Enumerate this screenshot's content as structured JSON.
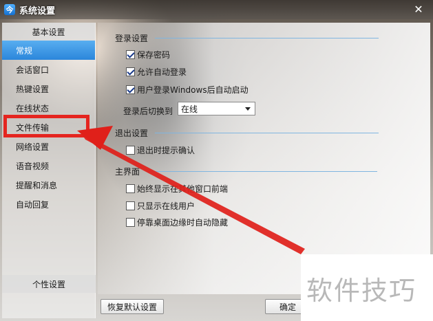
{
  "window": {
    "app_icon_glyph": "今",
    "title": "系统设置",
    "close_glyph": "✕"
  },
  "sidebar": {
    "header": "基本设置",
    "items": [
      {
        "label": "常规",
        "active": true
      },
      {
        "label": "会话窗口"
      },
      {
        "label": "热键设置"
      },
      {
        "label": "在线状态"
      },
      {
        "label": "文件传输"
      },
      {
        "label": "网络设置"
      },
      {
        "label": "语音视频"
      },
      {
        "label": "提醒和消息"
      },
      {
        "label": "自动回复"
      }
    ],
    "footer": "个性设置"
  },
  "login_section": {
    "title": "登录设置",
    "options": [
      {
        "label": "保存密码",
        "checked": true
      },
      {
        "label": "允许自动登录",
        "checked": true
      },
      {
        "label": "用户登录Windows后自动启动",
        "checked": true
      }
    ],
    "switch_label": "登录后切换到",
    "switch_value": "在线"
  },
  "exit_section": {
    "title": "退出设置",
    "options": [
      {
        "label": "退出时提示确认",
        "checked": false
      }
    ]
  },
  "main_section": {
    "title": "主界面",
    "options": [
      {
        "label": "始终显示在其他窗口前端",
        "checked": false
      },
      {
        "label": "只显示在线用户",
        "checked": false
      },
      {
        "label": "停靠桌面边缘时自动隐藏",
        "checked": false
      }
    ]
  },
  "footer_buttons": {
    "restore_default": "恢复默认设置",
    "ok": "确定"
  },
  "annotation": {
    "highlight_color": "#e5251f"
  },
  "watermark": "软件技巧"
}
